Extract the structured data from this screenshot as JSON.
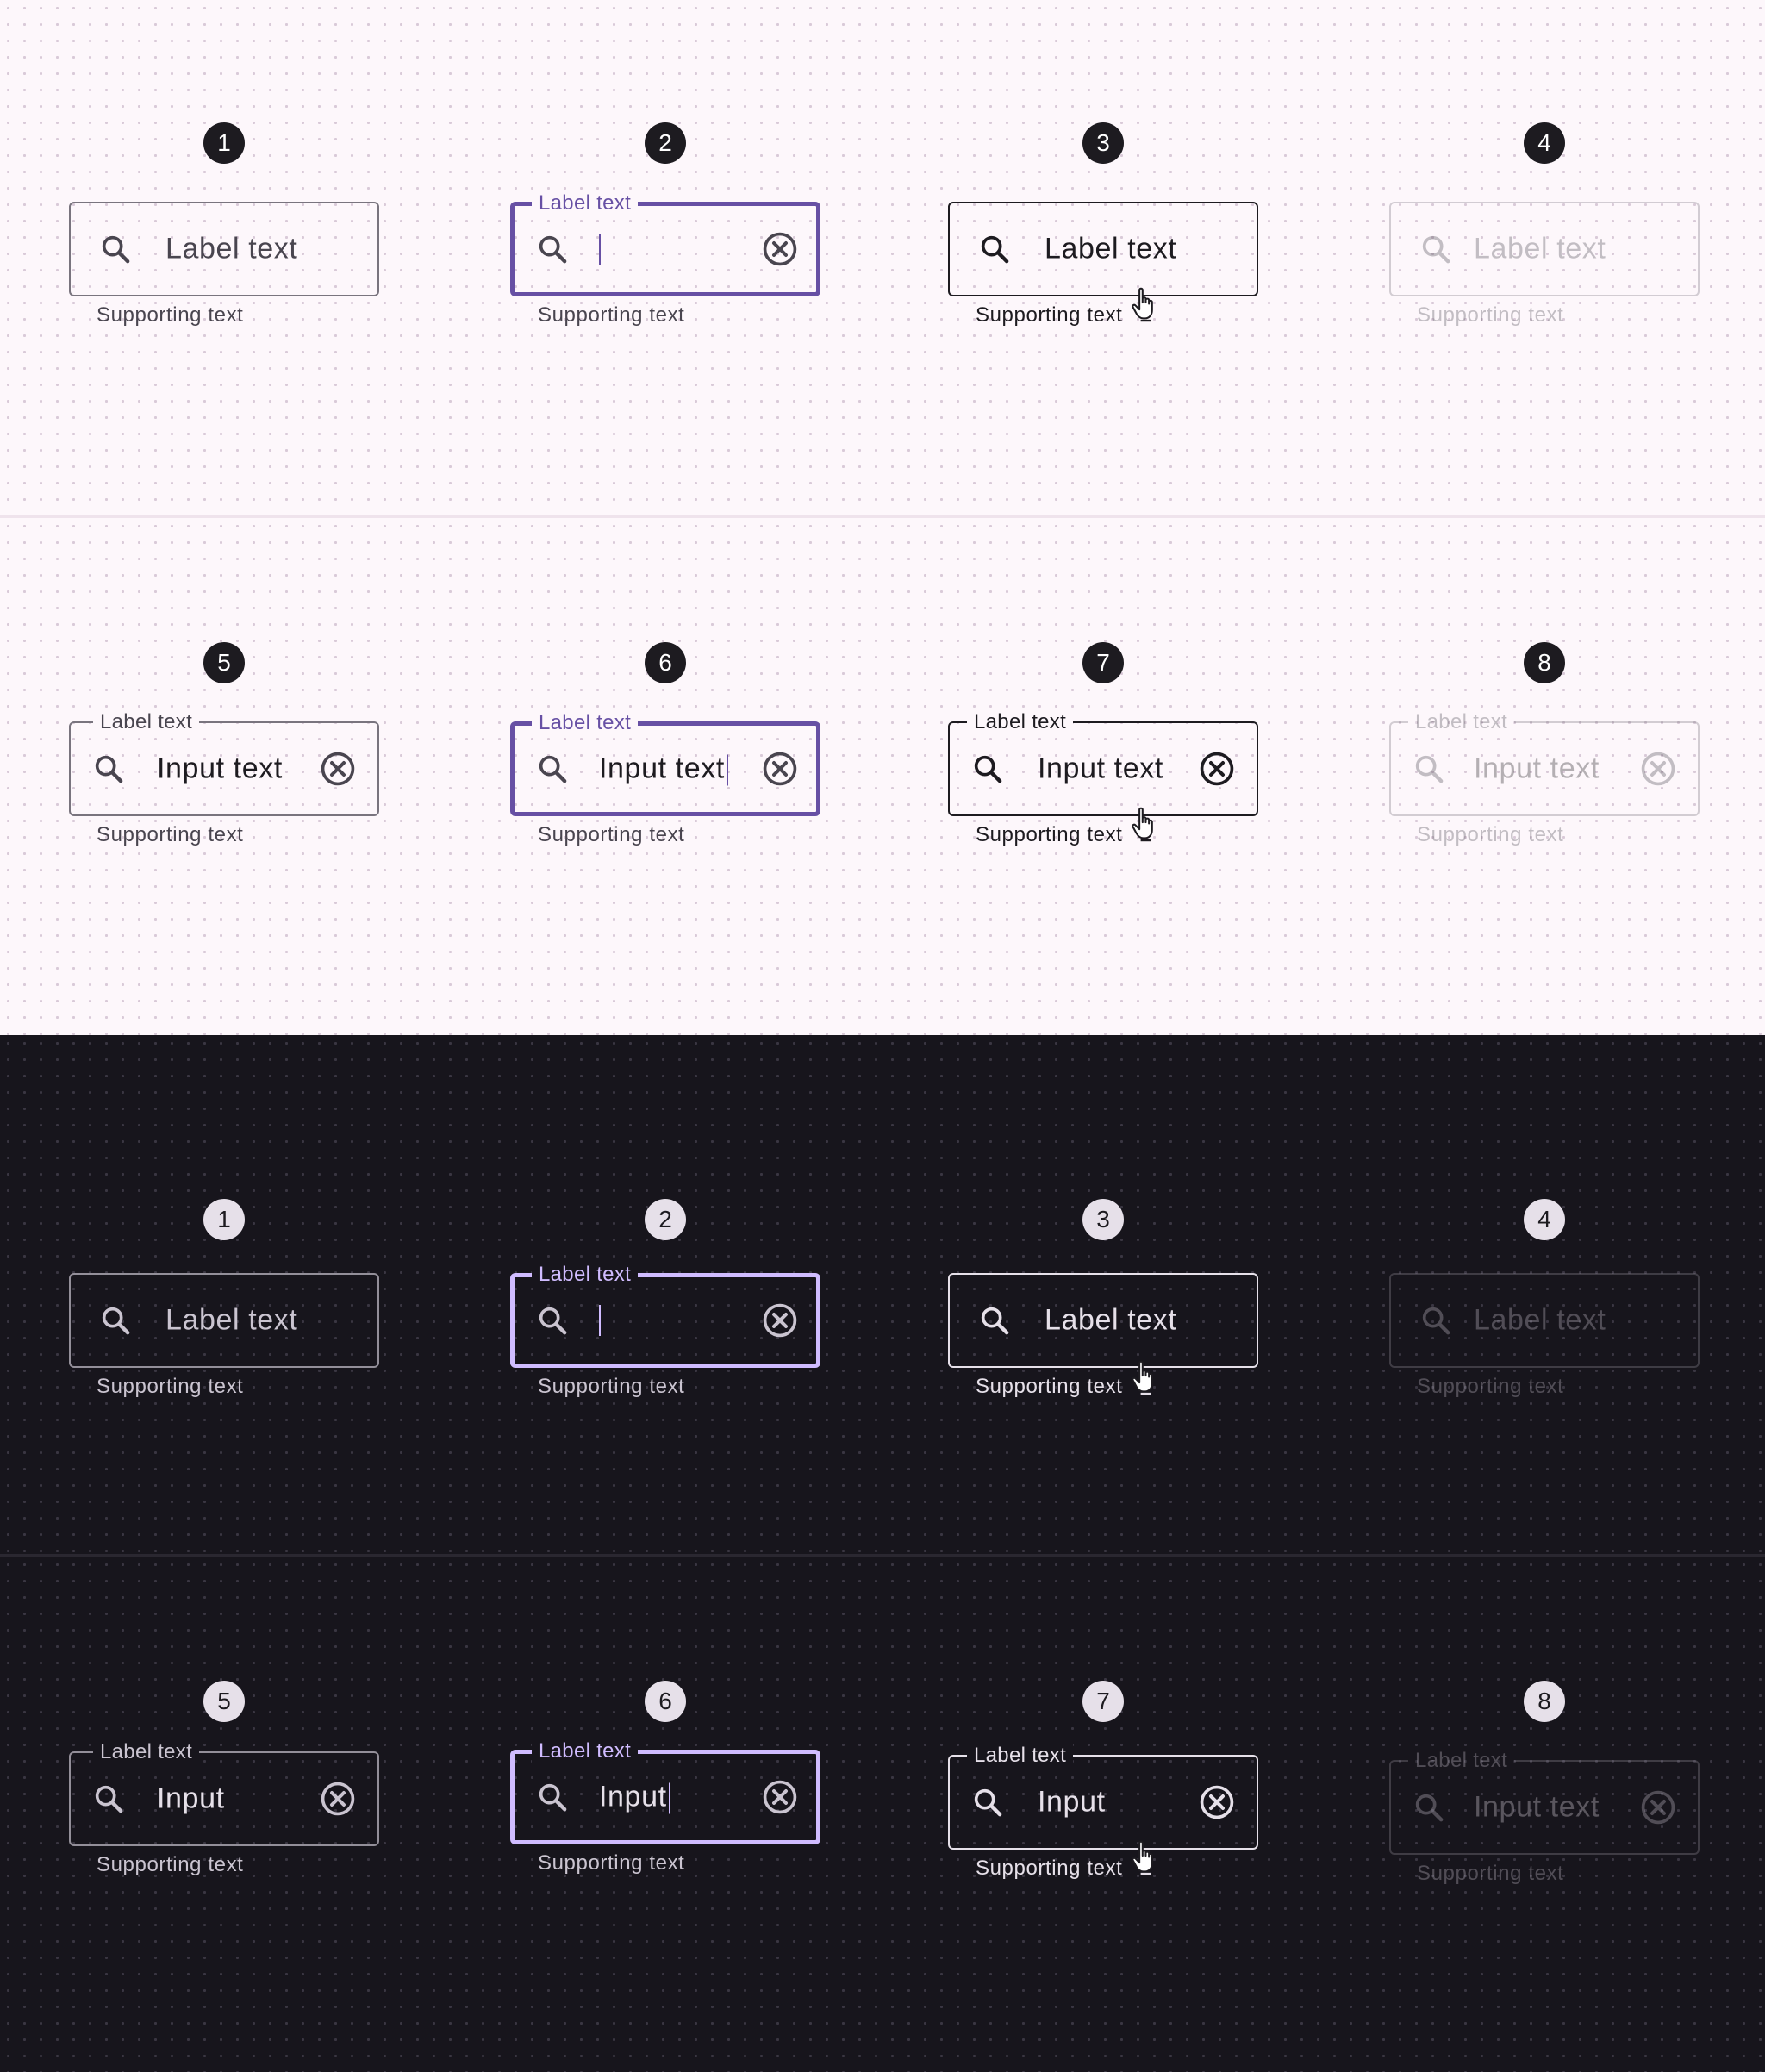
{
  "colors": {
    "light_background": "#fdf7fb",
    "dark_background": "#17151c",
    "light_primary": "#6750a4",
    "dark_primary": "#d0bcff",
    "light_on_surface": "#1d1b20",
    "dark_on_surface": "#e6e0e9"
  },
  "icons": {
    "leading": "search-icon",
    "trailing": "clear-circle-icon",
    "cursor": "hand-pointer-icon"
  },
  "light_resting": {
    "s1": {
      "badge": "1",
      "label": "",
      "text": "Label text",
      "support": "Supporting text"
    },
    "s2": {
      "badge": "2",
      "label": "Label text",
      "text": "",
      "support": "Supporting text"
    },
    "s3": {
      "badge": "3",
      "label": "",
      "text": "Label text",
      "support": "Supporting text"
    },
    "s4": {
      "badge": "4",
      "label": "",
      "text": "Label text",
      "support": "Supporting text"
    }
  },
  "light_filled": {
    "s5": {
      "badge": "5",
      "label": "Label text",
      "text": "Input text",
      "support": "Supporting text"
    },
    "s6": {
      "badge": "6",
      "label": "Label text",
      "text": "Input text",
      "support": "Supporting text"
    },
    "s7": {
      "badge": "7",
      "label": "Label text",
      "text": "Input text",
      "support": "Supporting text"
    },
    "s8": {
      "badge": "8",
      "label": "Label text",
      "text": "Input text",
      "support": "Supporting text"
    }
  },
  "dark_resting": {
    "s1": {
      "badge": "1",
      "label": "",
      "text": "Label text",
      "support": "Supporting text"
    },
    "s2": {
      "badge": "2",
      "label": "Label text",
      "text": "",
      "support": "Supporting text"
    },
    "s3": {
      "badge": "3",
      "label": "",
      "text": "Label text",
      "support": "Supporting text"
    },
    "s4": {
      "badge": "4",
      "label": "",
      "text": "Label text",
      "support": "Supporting text"
    }
  },
  "dark_filled": {
    "s5": {
      "badge": "5",
      "label": "Label text",
      "text": "Input",
      "support": "Supporting text"
    },
    "s6": {
      "badge": "6",
      "label": "Label text",
      "text": "Input",
      "support": "Supporting text"
    },
    "s7": {
      "badge": "7",
      "label": "Label text",
      "text": "Input",
      "support": "Supporting text"
    },
    "s8": {
      "badge": "8",
      "label": "Label text",
      "text": "Input text",
      "support": "Supporting text"
    }
  }
}
